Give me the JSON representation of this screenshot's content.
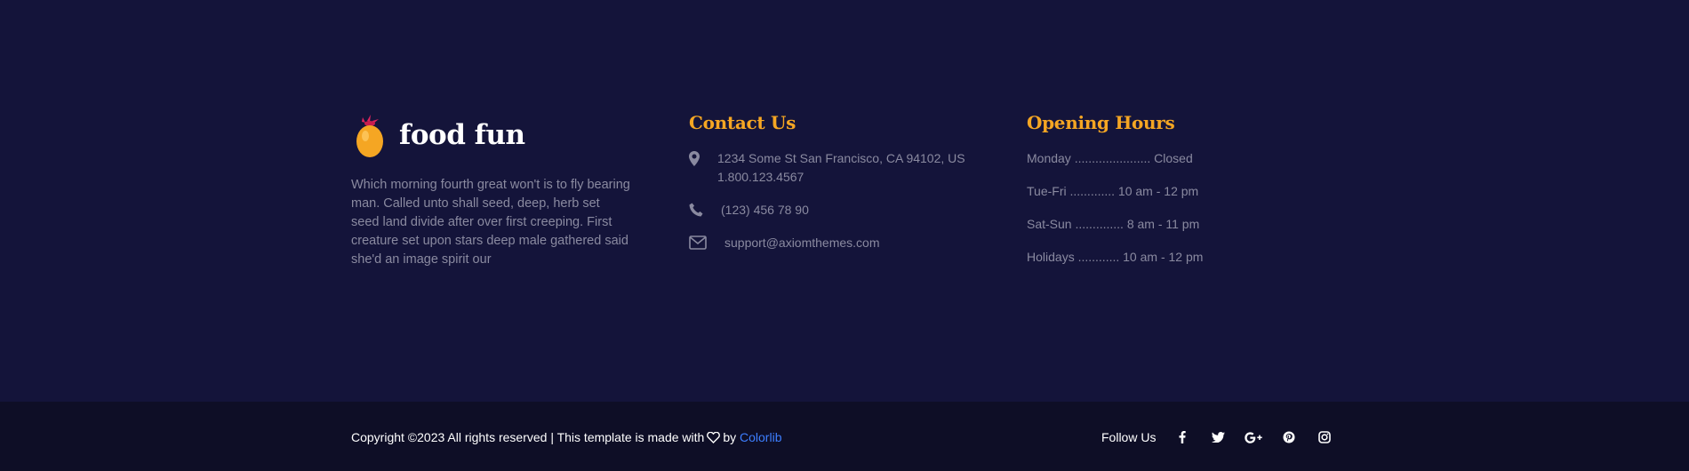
{
  "about": {
    "logo_text": "food fun",
    "description": "Which morning fourth great won't is to fly bearing man. Called unto shall seed, deep, herb set seed land divide after over first creeping. First creature set upon stars deep male gathered said she'd an image spirit our"
  },
  "contact": {
    "title": "Contact Us",
    "address_line1": "1234 Some St San Francisco, CA 94102, US",
    "address_line2": "1.800.123.4567",
    "phone": "(123) 456 78 90",
    "email": "support@axiomthemes.com"
  },
  "hours": {
    "title": "Opening Hours",
    "rows": [
      "Monday ...................... Closed",
      "Tue-Fri ............. 10 am - 12 pm",
      "Sat-Sun .............. 8 am - 11 pm",
      "Holidays ............ 10 am - 12 pm"
    ]
  },
  "bottom": {
    "copyright_prefix": "Copyright ©2023 All rights reserved | This template is made with",
    "by_text": "by",
    "link_text": "Colorlib",
    "follow_label": "Follow Us",
    "socials": [
      "facebook-icon",
      "twitter-icon",
      "google-plus-icon",
      "pinterest-icon",
      "instagram-icon"
    ]
  },
  "colors": {
    "background": "#14143a",
    "bottom_bar": "#0e0e26",
    "accent": "#f5a623",
    "link": "#3d7eff",
    "muted_text": "#8a8aa0"
  }
}
